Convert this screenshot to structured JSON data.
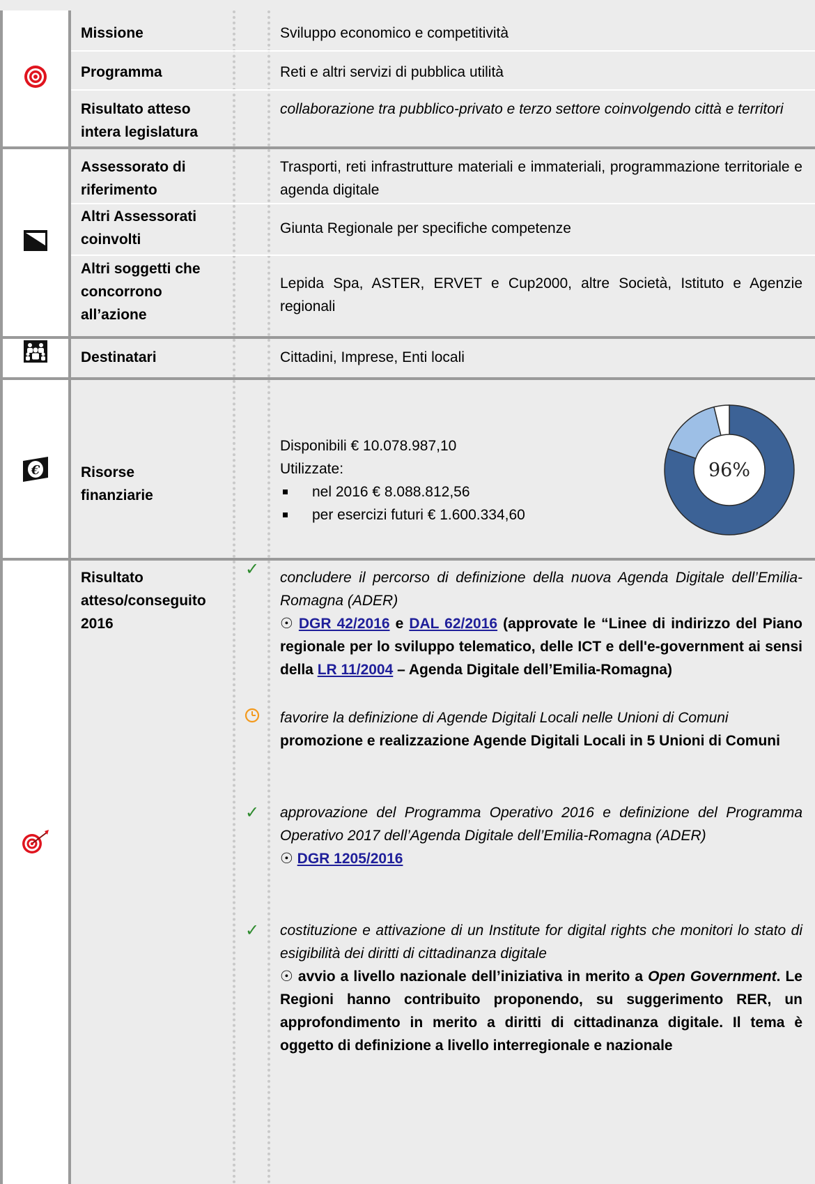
{
  "rows": {
    "missione": {
      "label": "Missione",
      "value": "Sviluppo economico e competitività"
    },
    "programma": {
      "label": "Programma",
      "value": "Reti e altri servizi di pubblica utilità"
    },
    "risultato_atteso": {
      "label_1": "Risultato atteso",
      "label_2": "intera legislatura",
      "value": "collaborazione tra pubblico-privato e terzo settore coinvolgendo città e territori"
    },
    "assessorato": {
      "label_1": "Assessorato di",
      "label_2": "riferimento",
      "value": "Trasporti, reti infrastrutture materiali e immateriali, programmazione territoriale e agenda digitale"
    },
    "altri_assessorati": {
      "label_1": "Altri Assessorati",
      "label_2": "coinvolti",
      "value": "Giunta Regionale per specifiche competenze"
    },
    "altri_soggetti": {
      "label_1": "Altri soggetti che",
      "label_2": "concorrono",
      "label_3": "all’azione",
      "value": "Lepida Spa, ASTER, ERVET e Cup2000, altre Società, Istituto e Agenzie regionali"
    },
    "destinatari": {
      "label": "Destinatari",
      "value": "Cittadini, Imprese, Enti locali"
    },
    "risorse": {
      "label_1": "Risorse",
      "label_2": "finanziarie",
      "disponibili": "Disponibili € 10.078.987,10",
      "utilizzate": "Utilizzate:",
      "items": [
        "nel 2016 € 8.088.812,56",
        "per esercizi futuri € 1.600.334,60"
      ],
      "donut_label": "96%",
      "donut_values": [
        80.3,
        15.9,
        3.8
      ],
      "donut_colors": [
        "#3c6296",
        "#9dbfe6",
        "#ffffff"
      ]
    },
    "risultato_2016": {
      "label_1": "Risultato",
      "label_2": "atteso/conseguito",
      "label_3": "2016",
      "items": [
        {
          "status_icon": "check-icon",
          "atteso": "concludere il percorso di definizione della nuova Agenda Digitale dell’Emilia-Romagna (ADER)",
          "link1": "DGR 42/2016",
          "and": "e",
          "link2": "DAL 62/2016",
          "text1": "(approvate le “Linee di indirizzo del Piano regionale per lo sviluppo telematico, delle ICT e dell'e-government ai sensi della",
          "link3": "LR 11/2004",
          "text2": "– Agenda Digitale dell’Emilia-Romagna)"
        },
        {
          "status_icon": "clock-icon",
          "atteso": "favorire la definizione di Agende Digitali Locali nelle Unioni di Comuni",
          "conseguito": "promozione e realizzazione Agende Digitali Locali in 5 Unioni di Comuni"
        },
        {
          "status_icon": "check-icon",
          "atteso": "approvazione del Programma Operativo 2016 e definizione del Programma Operativo 2017 dell’Agenda Digitale dell’Emilia-Romagna (ADER)",
          "link1": "DGR 1205/2016"
        },
        {
          "status_icon": "check-icon",
          "atteso": "costituzione e attivazione di un Institute for digital rights che monitori lo stato di esigibilità dei diritti di cittadinanza digitale",
          "c1": "avvio a livello nazionale dell’iniziativa in merito a",
          "c_em": "Open Government",
          "c2": ". Le Regioni hanno contribuito proponendo, su suggerimento RER, un approfondimento in merito a diritti di cittadinanza digitale. Il tema è oggetto di definizione a livello interregionale e nazionale"
        }
      ]
    }
  },
  "symbols": {
    "check": "✓",
    "bullet": "☉"
  },
  "colors": {
    "cell_bg": "#ececec",
    "border": "#9a9a9a",
    "target_red": "#e0141e",
    "donut_dark": "#3c6296",
    "donut_light": "#9dbfe6",
    "link": "#1f1f9a",
    "check_green": "#2e8b2e",
    "clock_orange": "#f39a1e"
  }
}
